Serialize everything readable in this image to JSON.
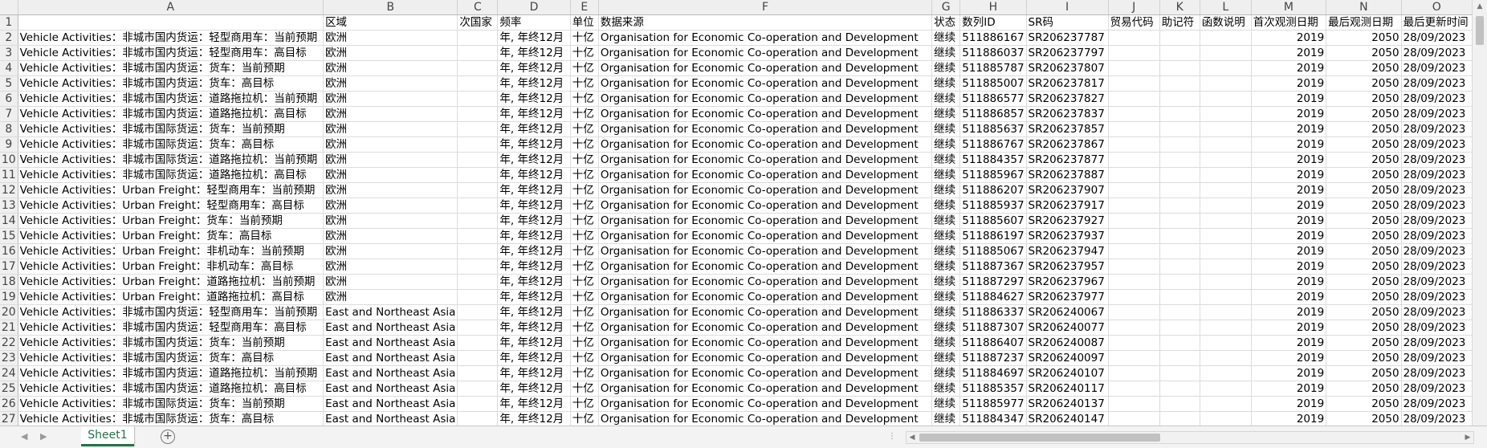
{
  "columns": [
    "A",
    "B",
    "C",
    "D",
    "E",
    "F",
    "G",
    "H",
    "I",
    "J",
    "K",
    "L",
    "M",
    "N",
    "O"
  ],
  "header": [
    "",
    "区域",
    "次国家",
    "频率",
    "单位",
    "数据来源",
    "状态",
    "数列ID",
    "SR码",
    "贸易代码",
    "助记符",
    "函数说明",
    "首次观测日期",
    "最后观测日期",
    "最后更新时间"
  ],
  "rows": [
    [
      "Vehicle Activities：非城市国内货运：轻型商用车：当前预期",
      "欧洲",
      "",
      "年, 年终12月",
      "十亿",
      "Organisation for Economic Co-operation and Development",
      "继续",
      "511886167",
      "SR206237787",
      "",
      "",
      "",
      "2019",
      "2050",
      "28/09/2023"
    ],
    [
      "Vehicle Activities：非城市国内货运：轻型商用车：高目标",
      "欧洲",
      "",
      "年, 年终12月",
      "十亿",
      "Organisation for Economic Co-operation and Development",
      "继续",
      "511886037",
      "SR206237797",
      "",
      "",
      "",
      "2019",
      "2050",
      "28/09/2023"
    ],
    [
      "Vehicle Activities：非城市国内货运：货车：当前预期",
      "欧洲",
      "",
      "年, 年终12月",
      "十亿",
      "Organisation for Economic Co-operation and Development",
      "继续",
      "511885787",
      "SR206237807",
      "",
      "",
      "",
      "2019",
      "2050",
      "28/09/2023"
    ],
    [
      "Vehicle Activities：非城市国内货运：货车：高目标",
      "欧洲",
      "",
      "年, 年终12月",
      "十亿",
      "Organisation for Economic Co-operation and Development",
      "继续",
      "511885007",
      "SR206237817",
      "",
      "",
      "",
      "2019",
      "2050",
      "28/09/2023"
    ],
    [
      "Vehicle Activities：非城市国内货运：道路拖拉机：当前预期",
      "欧洲",
      "",
      "年, 年终12月",
      "十亿",
      "Organisation for Economic Co-operation and Development",
      "继续",
      "511886577",
      "SR206237827",
      "",
      "",
      "",
      "2019",
      "2050",
      "28/09/2023"
    ],
    [
      "Vehicle Activities：非城市国内货运：道路拖拉机：高目标",
      "欧洲",
      "",
      "年, 年终12月",
      "十亿",
      "Organisation for Economic Co-operation and Development",
      "继续",
      "511886857",
      "SR206237837",
      "",
      "",
      "",
      "2019",
      "2050",
      "28/09/2023"
    ],
    [
      "Vehicle Activities：非城市国际货运：货车：当前预期",
      "欧洲",
      "",
      "年, 年终12月",
      "十亿",
      "Organisation for Economic Co-operation and Development",
      "继续",
      "511885637",
      "SR206237857",
      "",
      "",
      "",
      "2019",
      "2050",
      "28/09/2023"
    ],
    [
      "Vehicle Activities：非城市国际货运：货车：高目标",
      "欧洲",
      "",
      "年, 年终12月",
      "十亿",
      "Organisation for Economic Co-operation and Development",
      "继续",
      "511886767",
      "SR206237867",
      "",
      "",
      "",
      "2019",
      "2050",
      "28/09/2023"
    ],
    [
      "Vehicle Activities：非城市国际货运：道路拖拉机：当前预期",
      "欧洲",
      "",
      "年, 年终12月",
      "十亿",
      "Organisation for Economic Co-operation and Development",
      "继续",
      "511884357",
      "SR206237877",
      "",
      "",
      "",
      "2019",
      "2050",
      "28/09/2023"
    ],
    [
      "Vehicle Activities：非城市国际货运：道路拖拉机：高目标",
      "欧洲",
      "",
      "年, 年终12月",
      "十亿",
      "Organisation for Economic Co-operation and Development",
      "继续",
      "511885967",
      "SR206237887",
      "",
      "",
      "",
      "2019",
      "2050",
      "28/09/2023"
    ],
    [
      "Vehicle Activities：Urban Freight：轻型商用车：当前预期",
      "欧洲",
      "",
      "年, 年终12月",
      "十亿",
      "Organisation for Economic Co-operation and Development",
      "继续",
      "511886207",
      "SR206237907",
      "",
      "",
      "",
      "2019",
      "2050",
      "28/09/2023"
    ],
    [
      "Vehicle Activities：Urban Freight：轻型商用车：高目标",
      "欧洲",
      "",
      "年, 年终12月",
      "十亿",
      "Organisation for Economic Co-operation and Development",
      "继续",
      "511885937",
      "SR206237917",
      "",
      "",
      "",
      "2019",
      "2050",
      "28/09/2023"
    ],
    [
      "Vehicle Activities：Urban Freight：货车：当前预期",
      "欧洲",
      "",
      "年, 年终12月",
      "十亿",
      "Organisation for Economic Co-operation and Development",
      "继续",
      "511885607",
      "SR206237927",
      "",
      "",
      "",
      "2019",
      "2050",
      "28/09/2023"
    ],
    [
      "Vehicle Activities：Urban Freight：货车：高目标",
      "欧洲",
      "",
      "年, 年终12月",
      "十亿",
      "Organisation for Economic Co-operation and Development",
      "继续",
      "511886197",
      "SR206237937",
      "",
      "",
      "",
      "2019",
      "2050",
      "28/09/2023"
    ],
    [
      "Vehicle Activities：Urban Freight：非机动车：当前预期",
      "欧洲",
      "",
      "年, 年终12月",
      "十亿",
      "Organisation for Economic Co-operation and Development",
      "继续",
      "511885067",
      "SR206237947",
      "",
      "",
      "",
      "2019",
      "2050",
      "28/09/2023"
    ],
    [
      "Vehicle Activities：Urban Freight：非机动车：高目标",
      "欧洲",
      "",
      "年, 年终12月",
      "十亿",
      "Organisation for Economic Co-operation and Development",
      "继续",
      "511887367",
      "SR206237957",
      "",
      "",
      "",
      "2019",
      "2050",
      "28/09/2023"
    ],
    [
      "Vehicle Activities：Urban Freight：道路拖拉机：当前预期",
      "欧洲",
      "",
      "年, 年终12月",
      "十亿",
      "Organisation for Economic Co-operation and Development",
      "继续",
      "511887297",
      "SR206237967",
      "",
      "",
      "",
      "2019",
      "2050",
      "28/09/2023"
    ],
    [
      "Vehicle Activities：Urban Freight：道路拖拉机：高目标",
      "欧洲",
      "",
      "年, 年终12月",
      "十亿",
      "Organisation for Economic Co-operation and Development",
      "继续",
      "511884627",
      "SR206237977",
      "",
      "",
      "",
      "2019",
      "2050",
      "28/09/2023"
    ],
    [
      "Vehicle Activities：非城市国内货运：轻型商用车：当前预期",
      "East and Northeast Asia",
      "",
      "年, 年终12月",
      "十亿",
      "Organisation for Economic Co-operation and Development",
      "继续",
      "511886337",
      "SR206240067",
      "",
      "",
      "",
      "2019",
      "2050",
      "28/09/2023"
    ],
    [
      "Vehicle Activities：非城市国内货运：轻型商用车：高目标",
      "East and Northeast Asia",
      "",
      "年, 年终12月",
      "十亿",
      "Organisation for Economic Co-operation and Development",
      "继续",
      "511887307",
      "SR206240077",
      "",
      "",
      "",
      "2019",
      "2050",
      "28/09/2023"
    ],
    [
      "Vehicle Activities：非城市国内货运：货车：当前预期",
      "East and Northeast Asia",
      "",
      "年, 年终12月",
      "十亿",
      "Organisation for Economic Co-operation and Development",
      "继续",
      "511886407",
      "SR206240087",
      "",
      "",
      "",
      "2019",
      "2050",
      "28/09/2023"
    ],
    [
      "Vehicle Activities：非城市国内货运：货车：高目标",
      "East and Northeast Asia",
      "",
      "年, 年终12月",
      "十亿",
      "Organisation for Economic Co-operation and Development",
      "继续",
      "511887237",
      "SR206240097",
      "",
      "",
      "",
      "2019",
      "2050",
      "28/09/2023"
    ],
    [
      "Vehicle Activities：非城市国内货运：道路拖拉机：当前预期",
      "East and Northeast Asia",
      "",
      "年, 年终12月",
      "十亿",
      "Organisation for Economic Co-operation and Development",
      "继续",
      "511884697",
      "SR206240107",
      "",
      "",
      "",
      "2019",
      "2050",
      "28/09/2023"
    ],
    [
      "Vehicle Activities：非城市国内货运：道路拖拉机：高目标",
      "East and Northeast Asia",
      "",
      "年, 年终12月",
      "十亿",
      "Organisation for Economic Co-operation and Development",
      "继续",
      "511885357",
      "SR206240117",
      "",
      "",
      "",
      "2019",
      "2050",
      "28/09/2023"
    ],
    [
      "Vehicle Activities：非城市国际货运：货车：当前预期",
      "East and Northeast Asia",
      "",
      "年, 年终12月",
      "十亿",
      "Organisation for Economic Co-operation and Development",
      "继续",
      "511885977",
      "SR206240137",
      "",
      "",
      "",
      "2019",
      "2050",
      "28/09/2023"
    ],
    [
      "Vehicle Activities：非城市国际货运：货车：高目标",
      "East and Northeast Asia",
      "",
      "年, 年终12月",
      "十亿",
      "Organisation for Economic Co-operation and Development",
      "继续",
      "511884347",
      "SR206240147",
      "",
      "",
      "",
      "2019",
      "2050",
      "28/09/2023"
    ]
  ],
  "sheet_tab": "Sheet1",
  "add_sheet_icon": "plus-circle-icon"
}
